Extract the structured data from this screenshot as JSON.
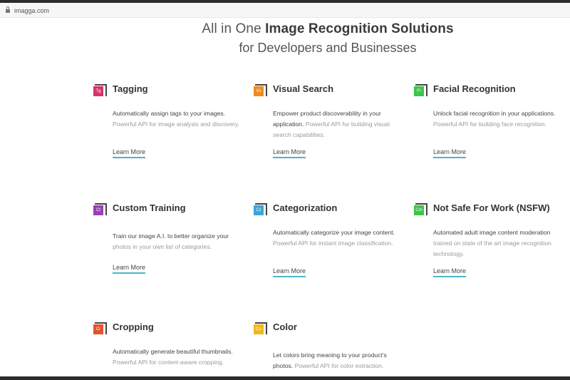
{
  "browser": {
    "url": "imagga.com"
  },
  "hero": {
    "line1_pre": "All in One ",
    "line1_bold": "Image Recognition Solutions",
    "line2": "for Developers and Businesses"
  },
  "cards": [
    {
      "badge": "Tg",
      "color": "#d6336c",
      "title": "Tagging",
      "desc_dark": "Automatically assign tags to your images.",
      "desc_light": "Powerful API for image analysis and discovery.",
      "link": "Learn More"
    },
    {
      "badge": "Vs",
      "color": "#f08a24",
      "title": "Visual Search",
      "desc_dark": "Empower product discoverability in your application.",
      "desc_light": "Powerful API for building visual search capabilities.",
      "link": "Learn More"
    },
    {
      "badge": "Fr",
      "color": "#3cc64a",
      "title": "Facial Recognition",
      "desc_dark": "Unlock facial recognition in your applications.",
      "desc_light": "Powerful API for building face recognition.",
      "link": "Learn More"
    },
    {
      "badge": "Ct",
      "color": "#9b3fb5",
      "title": "Custom Training",
      "desc_dark": "Train our image A.I. to better organize your",
      "desc_light": "photos in your own list of categories.",
      "link": "Learn More"
    },
    {
      "badge": "Cz",
      "color": "#3aa6d8",
      "title": "Categorization",
      "desc_dark": "Automatically categorize your image content.",
      "desc_light": "Powerful API for instant image classification.",
      "link": "Learn More"
    },
    {
      "badge": "Cm",
      "color": "#3cc64a",
      "title": "Not Safe For Work (NSFW)",
      "desc_dark": "Automated adult image content moderation",
      "desc_light": "trained on state of the art image recognition technology.",
      "link": "Learn More"
    },
    {
      "badge": "Cr",
      "color": "#e2542c",
      "title": "Cropping",
      "desc_dark": "Automatically generate beautiful thumbnails.",
      "desc_light": "Powerful API for content-aware cropping.",
      "link": ""
    },
    {
      "badge": "Co",
      "color": "#f0b81c",
      "title": "Color",
      "desc_dark": "Let colors bring meaning to your product's photos.",
      "desc_light": "Powerful API for color extraction.",
      "link": ""
    }
  ]
}
